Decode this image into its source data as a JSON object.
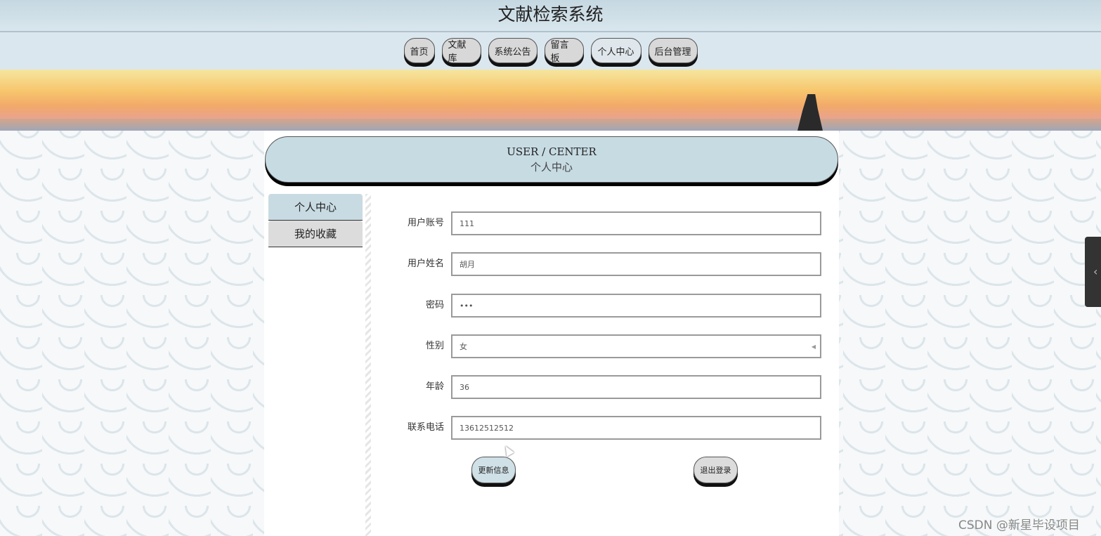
{
  "site": {
    "title": "文献检索系统"
  },
  "nav": {
    "items": [
      {
        "label": "首页"
      },
      {
        "label": "文献库"
      },
      {
        "label": "系统公告"
      },
      {
        "label": "留言板"
      },
      {
        "label": "个人中心"
      },
      {
        "label": "后台管理"
      }
    ],
    "active": "个人中心"
  },
  "center": {
    "en_title": "USER / CENTER",
    "cn_title": "个人中心"
  },
  "sidemenu": {
    "items": [
      {
        "label": "个人中心"
      },
      {
        "label": "我的收藏"
      }
    ]
  },
  "form": {
    "account_label": "用户账号",
    "account_value": "111",
    "name_label": "用户姓名",
    "name_value": "胡月",
    "password_label": "密码",
    "password_value": "•••",
    "gender_label": "性别",
    "gender_value": "女",
    "age_label": "年龄",
    "age_value": "36",
    "phone_label": "联系电话",
    "phone_value": "13612512512",
    "update_label": "更新信息",
    "logout_label": "退出登录"
  },
  "watermark": "CSDN @新星毕设项目"
}
